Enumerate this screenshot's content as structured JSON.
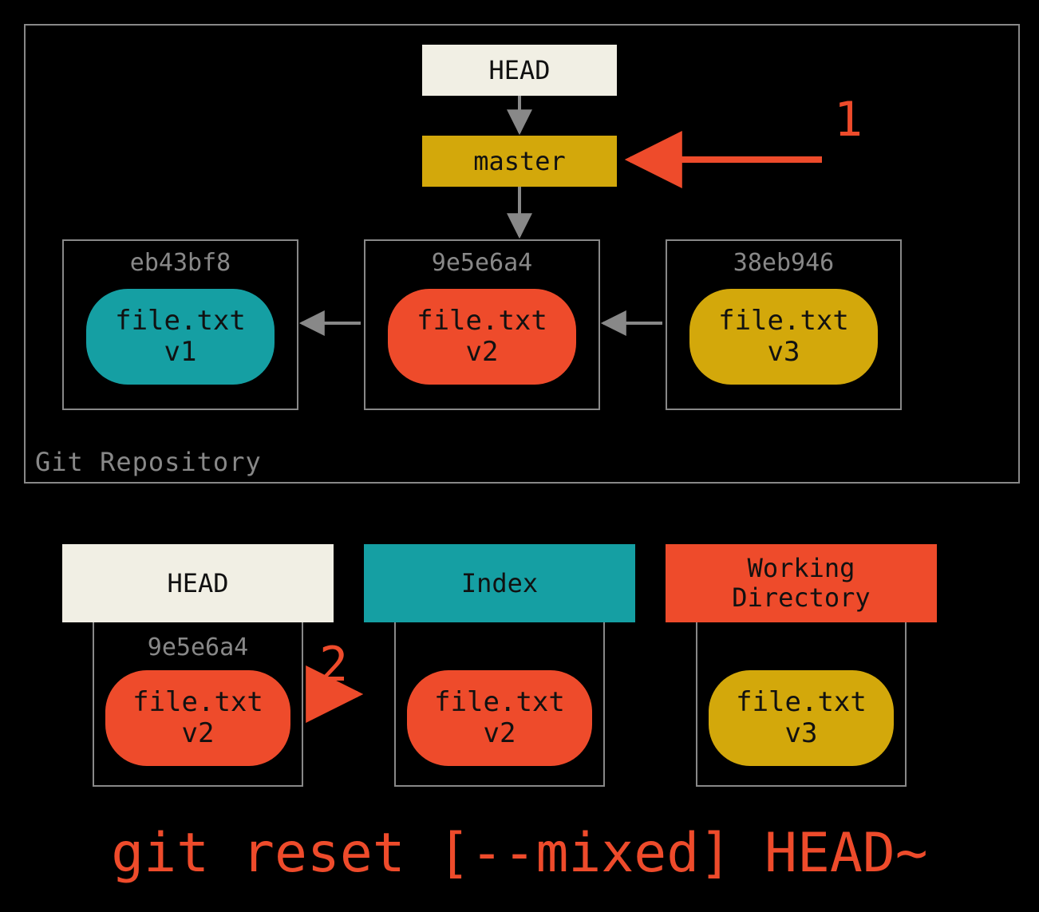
{
  "repo": {
    "label": "Git Repository",
    "head_label": "HEAD",
    "branch_label": "master",
    "commits": [
      {
        "hash": "eb43bf8",
        "file": "file.txt",
        "version": "v1",
        "color": "teal"
      },
      {
        "hash": "9e5e6a4",
        "file": "file.txt",
        "version": "v2",
        "color": "red"
      },
      {
        "hash": "38eb946",
        "file": "file.txt",
        "version": "v3",
        "color": "gold"
      }
    ]
  },
  "steps": {
    "one": "1",
    "two": "2"
  },
  "areas": {
    "head": {
      "title": "HEAD",
      "hash": "9e5e6a4",
      "file": "file.txt",
      "version": "v2",
      "blob_color": "red",
      "hdr_color": "cream"
    },
    "index": {
      "title": "Index",
      "hash": "",
      "file": "file.txt",
      "version": "v2",
      "blob_color": "red",
      "hdr_color": "teal"
    },
    "wd": {
      "title": "Working\nDirectory",
      "hash": "",
      "file": "file.txt",
      "version": "v3",
      "blob_color": "gold",
      "hdr_color": "red"
    }
  },
  "command": "git reset [--mixed] HEAD~",
  "colors": {
    "teal": "#159fa3",
    "red": "#ee4b2b",
    "gold": "#d3a80b",
    "cream": "#f1efe4",
    "frame": "#888888"
  }
}
